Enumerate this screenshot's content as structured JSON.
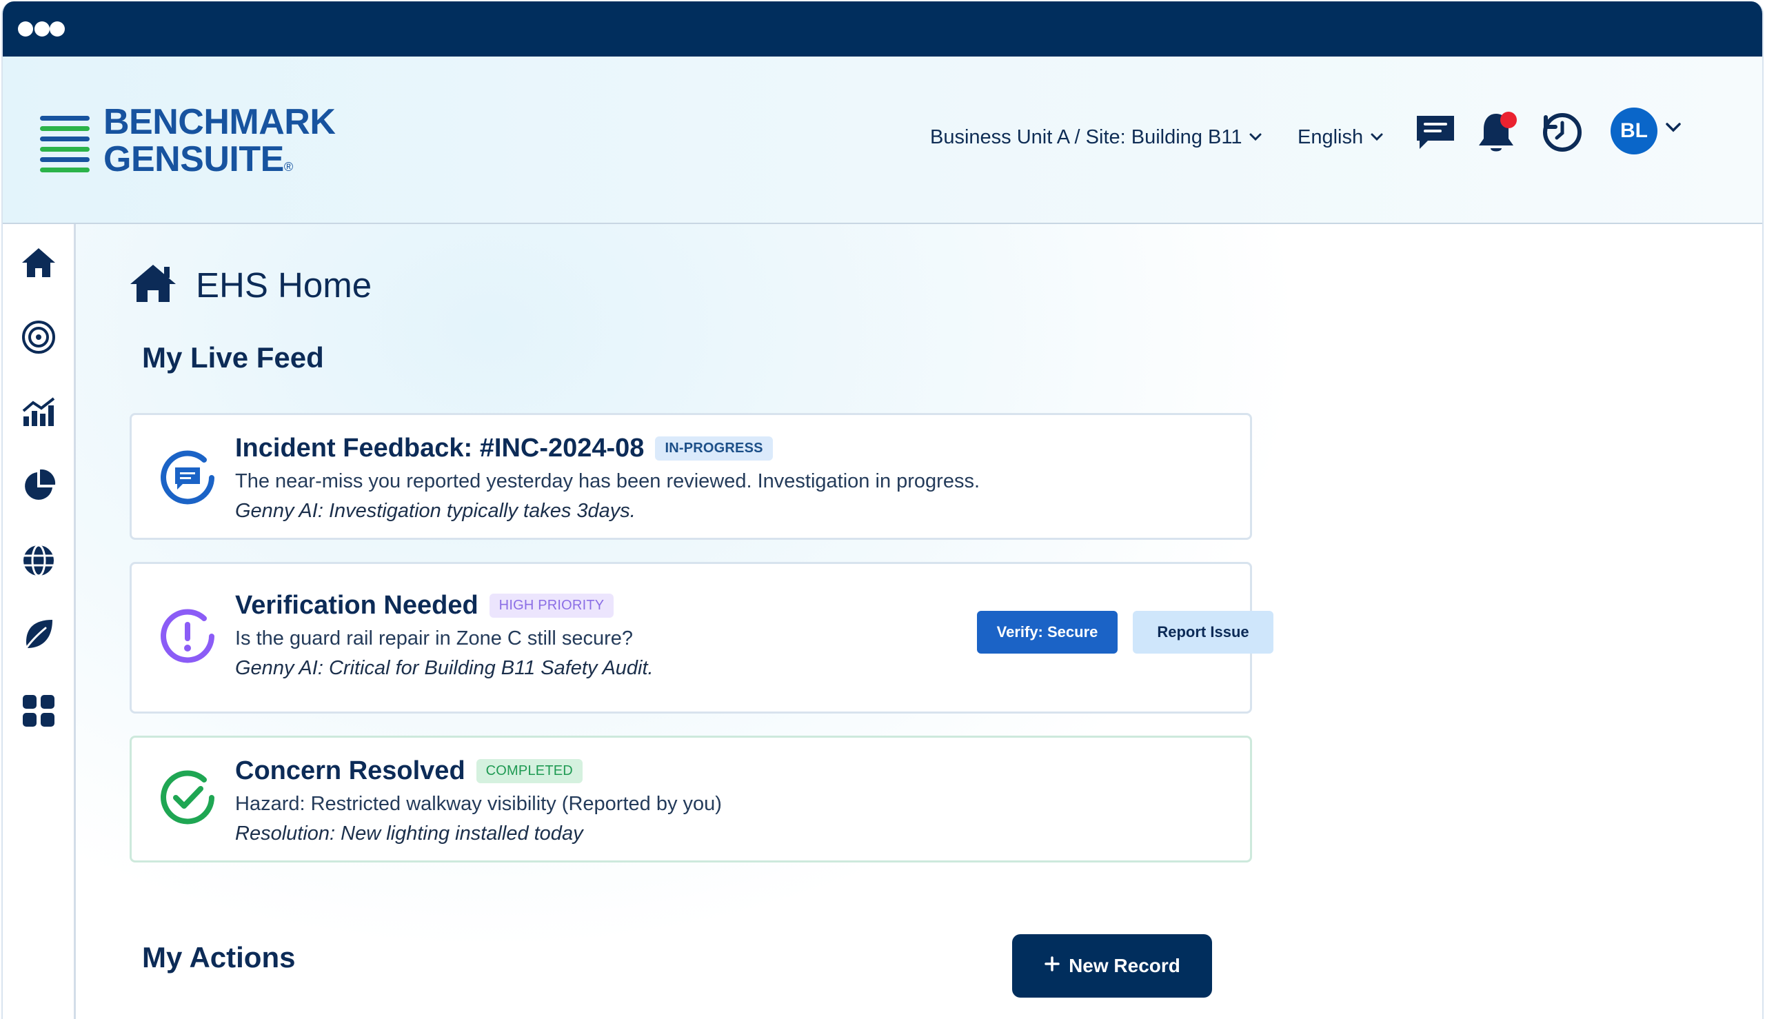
{
  "brand": {
    "line1": "BENCHMARK",
    "line2": "GENSUITE",
    "registered_mark": "®",
    "colors": {
      "navy": "#012e5d",
      "blue": "#17539f",
      "green": "#2bb34a"
    }
  },
  "header": {
    "site_selector": "Business Unit A / Site: Building B11",
    "language": "English",
    "icons": [
      "message-icon",
      "bell-icon",
      "history-icon"
    ],
    "notification_dot_color": "#ea2230",
    "user_initials": "BL"
  },
  "sidebar": {
    "items": [
      {
        "name": "home",
        "icon": "home-icon"
      },
      {
        "name": "target",
        "icon": "target-icon"
      },
      {
        "name": "analytics",
        "icon": "chart-icon"
      },
      {
        "name": "reports",
        "icon": "pie-chart-icon"
      },
      {
        "name": "global",
        "icon": "globe-icon"
      },
      {
        "name": "sustainability",
        "icon": "leaf-icon"
      },
      {
        "name": "apps",
        "icon": "grid-icon"
      }
    ]
  },
  "page": {
    "title": "EHS Home",
    "live_feed_title": "My Live Feed",
    "actions_title": "My Actions",
    "new_record_label": "New Record"
  },
  "feed": [
    {
      "title": "Incident Feedback: #INC-2024-08",
      "status": "IN-PROGRESS",
      "description": "The near-miss you reported yesterday has been reviewed. Investigation in progress.",
      "ai_note": "Genny AI: Investigation typically takes 3days.",
      "icon": "incident-message-icon",
      "accent": "#1b63c6"
    },
    {
      "title": "Verification Needed",
      "status": "HIGH PRIORITY",
      "description": "Is the guard rail repair in Zone C still secure?",
      "ai_note": "Genny AI: Critical for Building B11 Safety Audit.",
      "icon": "alert-icon",
      "accent": "#8b5cf6",
      "primary_action": "Verify: Secure",
      "secondary_action": "Report Issue"
    },
    {
      "title": "Concern Resolved",
      "status": "COMPLETED",
      "description": "Hazard: Restricted walkway visibility (Reported by you)",
      "ai_note": "Resolution: New lighting installed today",
      "icon": "check-circle-icon",
      "accent": "#1fa653"
    }
  ]
}
